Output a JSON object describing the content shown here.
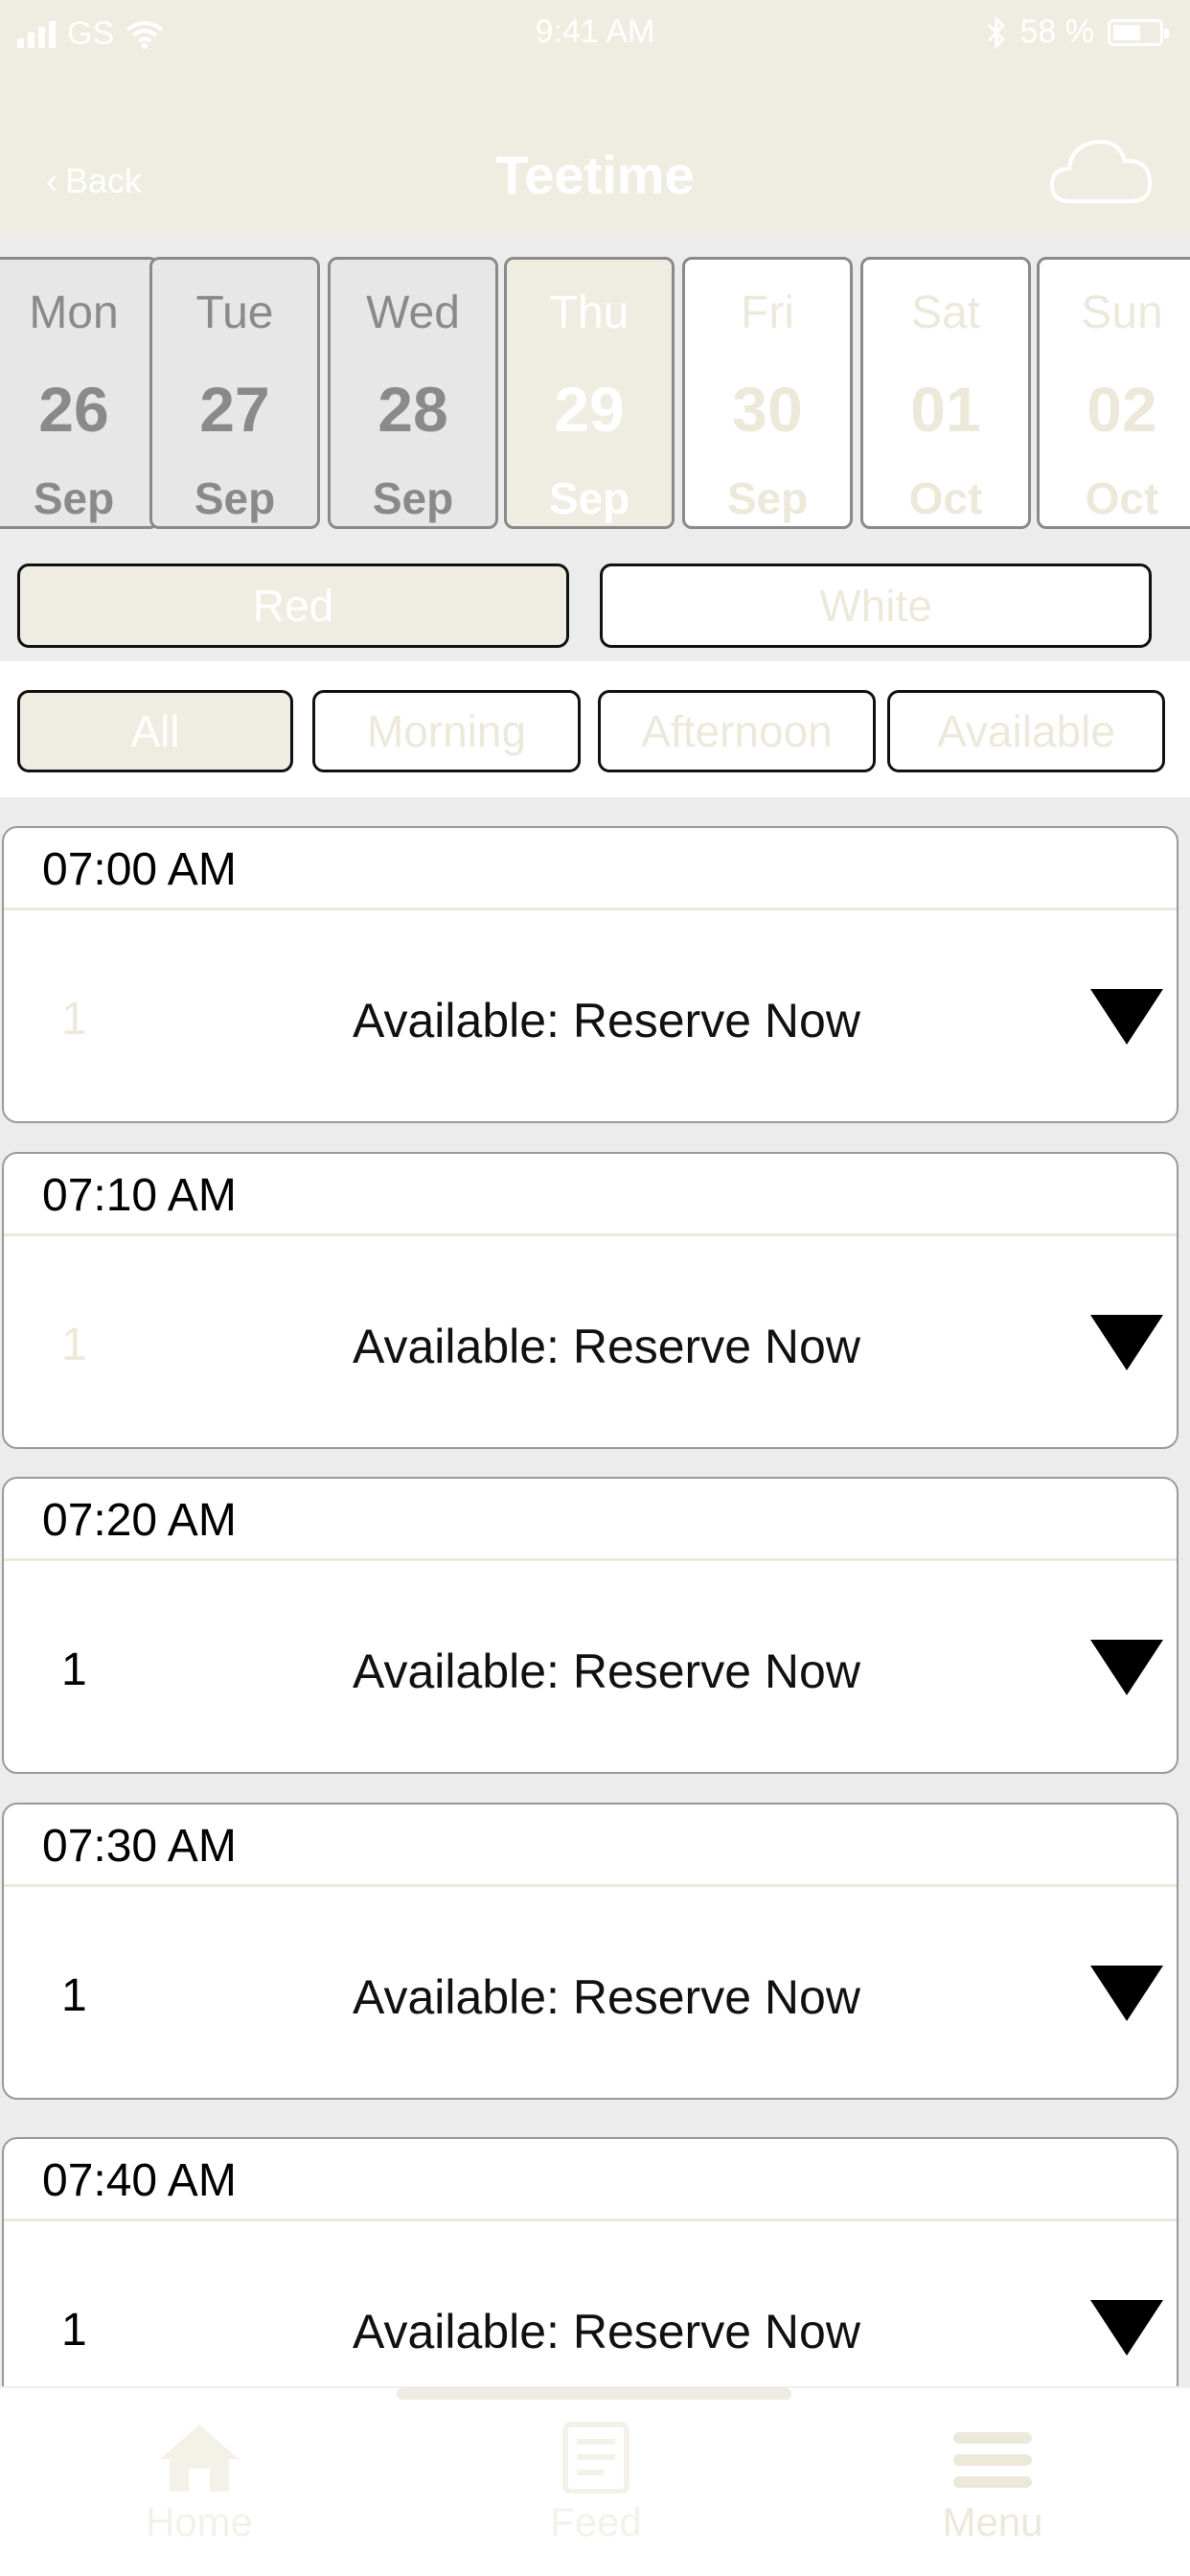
{
  "status_bar": {
    "carrier": "GS",
    "time": "9:41 AM",
    "battery_percent": "58 %",
    "battery_level": 0.58
  },
  "nav": {
    "back_label": "Back",
    "title": "Teetime",
    "weather_icon": "cloud-icon"
  },
  "dates": [
    {
      "day": "Mon",
      "num": "26",
      "month": "Sep",
      "state": "past"
    },
    {
      "day": "Tue",
      "num": "27",
      "month": "Sep",
      "state": "past"
    },
    {
      "day": "Wed",
      "num": "28",
      "month": "Sep",
      "state": "past"
    },
    {
      "day": "Thu",
      "num": "29",
      "month": "Sep",
      "state": "selected"
    },
    {
      "day": "Fri",
      "num": "30",
      "month": "Sep",
      "state": "future"
    },
    {
      "day": "Sat",
      "num": "01",
      "month": "Oct",
      "state": "future"
    },
    {
      "day": "Sun",
      "num": "02",
      "month": "Oct",
      "state": "future"
    }
  ],
  "courses": [
    {
      "label": "Red",
      "active": true
    },
    {
      "label": "White",
      "active": false
    }
  ],
  "filters": [
    {
      "label": "All",
      "active": true
    },
    {
      "label": "Morning",
      "active": false
    },
    {
      "label": "Afternoon",
      "active": false
    },
    {
      "label": "Available",
      "active": false
    }
  ],
  "teetimes": [
    {
      "time": "07:00 AM",
      "slots": "1",
      "slots_faded": true,
      "status": "Available: Reserve Now"
    },
    {
      "time": "07:10 AM",
      "slots": "1",
      "slots_faded": true,
      "status": "Available: Reserve Now"
    },
    {
      "time": "07:20 AM",
      "slots": "1",
      "slots_faded": false,
      "status": "Available: Reserve Now"
    },
    {
      "time": "07:30 AM",
      "slots": "1",
      "slots_faded": false,
      "status": "Available: Reserve Now"
    },
    {
      "time": "07:40 AM",
      "slots": "1",
      "slots_faded": false,
      "status": "Available: Reserve Now"
    }
  ],
  "tabbar": {
    "home": "Home",
    "feed": "Feed",
    "menu": "Menu"
  },
  "colors": {
    "accent": "#efede1",
    "accent_text": "#ece9da",
    "background": "#ececec"
  }
}
